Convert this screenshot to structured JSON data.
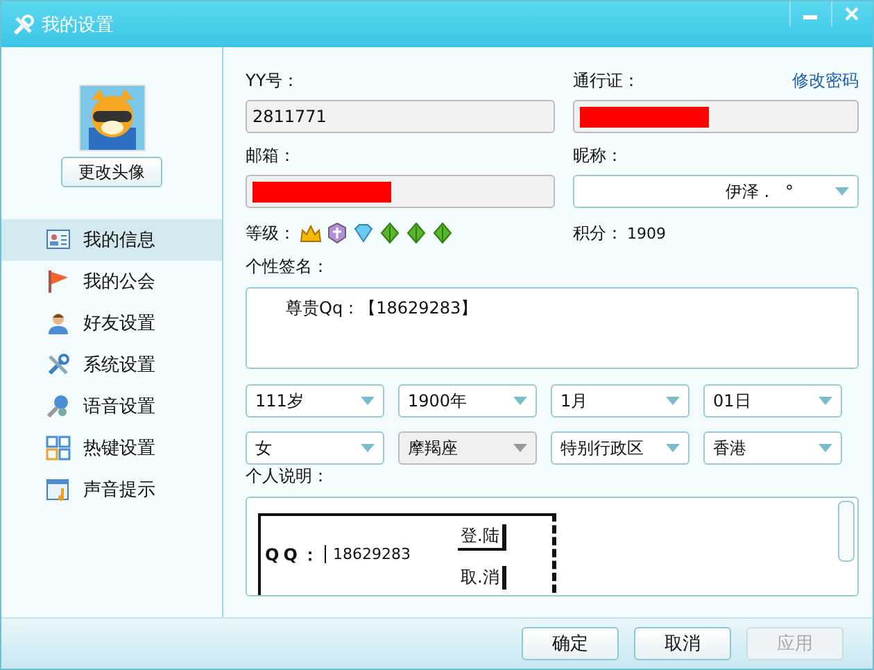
{
  "window": {
    "title": "我的设置"
  },
  "sidebar": {
    "avatar_button": "更改头像",
    "items": [
      {
        "label": "我的信息",
        "selected": true,
        "kind": "card"
      },
      {
        "label": "我的公会",
        "selected": false,
        "kind": "flag"
      },
      {
        "label": "好友设置",
        "selected": false,
        "kind": "person"
      },
      {
        "label": "系统设置",
        "selected": false,
        "kind": "tools"
      },
      {
        "label": "语音设置",
        "selected": false,
        "kind": "voice"
      },
      {
        "label": "热键设置",
        "selected": false,
        "kind": "grid"
      },
      {
        "label": "声音提示",
        "selected": false,
        "kind": "note"
      }
    ]
  },
  "profile": {
    "yy_label": "YY号：",
    "yy_value": "2811771",
    "pass_label": "通行证：",
    "change_password": "修改密码",
    "email_label": "邮箱：",
    "nick_label": "昵称：",
    "nick_value": "伊泽 .   °",
    "level_label": "等级：",
    "points_label": "积分：",
    "points": "1909",
    "signature_label": "个性签名：",
    "signature": "尊贵Qq：【18629283】",
    "selects": [
      {
        "value": "111岁",
        "disabled": false
      },
      {
        "value": "1900年",
        "disabled": false
      },
      {
        "value": "1月",
        "disabled": false
      },
      {
        "value": "01日",
        "disabled": false
      },
      {
        "value": "女",
        "disabled": false
      },
      {
        "value": "摩羯座",
        "disabled": true
      },
      {
        "value": "特别行政区",
        "disabled": false
      },
      {
        "value": "香港",
        "disabled": false
      }
    ],
    "about_label": "个人说明：",
    "about_art": {
      "qq_label": "QQ：",
      "qq_value": "18629283",
      "login": "登.陆",
      "cancel": "取.消"
    }
  },
  "buttons": [
    {
      "label": "确定",
      "disabled": false
    },
    {
      "label": "取消",
      "disabled": false
    },
    {
      "label": "应用",
      "disabled": true
    }
  ]
}
